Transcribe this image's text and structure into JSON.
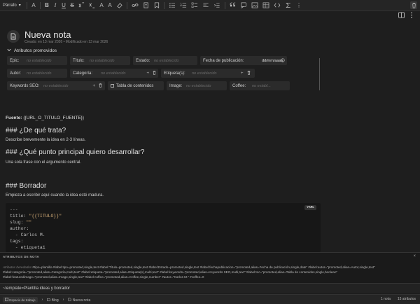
{
  "toolbar": {
    "paragraph_style": "Párrafo",
    "dropdown_arrow": "▾",
    "buttons": [
      "A",
      "B",
      "I",
      "U",
      "S",
      "A",
      "A",
      "⇄"
    ],
    "more": "⋮"
  },
  "note": {
    "title": "Nueva nota",
    "meta": "Creado: en 13 mar 2026 • Modificado en 13 mar 2026"
  },
  "attributes": {
    "toggle_label": "Atributos promovidos",
    "epic": {
      "label": "Epic:",
      "value": "no establecido"
    },
    "titulo": {
      "label": "Título:",
      "value": "no establecido"
    },
    "estado": {
      "label": "Estado:",
      "value": "no establecido"
    },
    "fecha": {
      "label": "Fecha de publicación:",
      "value": "dd/mm/aaaa"
    },
    "autor": {
      "label": "Autor:",
      "value": "no establecido"
    },
    "categoria": {
      "label": "Categoría:",
      "value": "no establecido"
    },
    "etiqueta": {
      "label": "Etiqueta(s):",
      "value": "no establecido"
    },
    "keywords": {
      "label": "Keywords SEO:",
      "value": "no establecido"
    },
    "tabla": {
      "label": "Tabla de contenidos"
    },
    "image": {
      "label": "Image:",
      "value": "no establecido"
    },
    "coffee": {
      "label": "Coffee:",
      "value": "no establ..."
    }
  },
  "content": {
    "fuente_label": "Fuente:",
    "fuente_value": "{{URL_O_TITULO_FUENTE}}",
    "h1": "### ¿De qué trata?",
    "p1": "Describe brevemente la idea en 2-3 líneas.",
    "h2": "### ¿Qué punto principal quiero desarrollar?",
    "p2": "Una sola frase con el argumento central.",
    "h3": "### Borrador",
    "p3": "Empieza a escribir aquí cuando la idea esté madura."
  },
  "code": {
    "tag": "YAML",
    "l1": "---",
    "l2a": "title: ",
    "l2b": "\"{{TITULO}}\"",
    "l3a": "slug: ",
    "l3b": "\"\"",
    "l4": "author:",
    "l5": "  - Carlos M.",
    "l6": "tags:",
    "l7": "  - etiqueta1"
  },
  "panel": {
    "title": "ATRIBUTOS DE NOTA",
    "hint": "Atributos heredados",
    "text": "#tipo=plantilla #label:tipo=promoted,single,text #label:Título=promoted,single,text #label:Estado=promoted,single,text #label:fechapublicacion=\"promoted,alias=Fecha de publicación,single,date\" #label:autor=\"promoted,alias=Autor,single,text\" #label:categoria=\"promoted,alias=Categoría,multi,text\" #label:etiqueta=\"promoted,alias=Etiqueta(s),multi,text\" #label:keywords=\"promoted,alias=Keywords SEO,multi,text\" #label:toc=\"promoted,alias=Tabla de contenidos,single,boolean\" #label:featuredimage=\"promoted,alias=Image,single,text\" #label:coffee=\"promoted,alias=Coffee,single,number\" #autor=\"Carlos M.\" #coffee=0",
    "input": "~template=Plantilla ideas y borrador",
    "close": "×"
  },
  "status": {
    "workspace": "Espacio de trabajo",
    "crumb1": "Blog",
    "crumb2": "Nueva nota",
    "notes": "1 nota",
    "tasks": "15 atributos",
    "sep": "›"
  }
}
